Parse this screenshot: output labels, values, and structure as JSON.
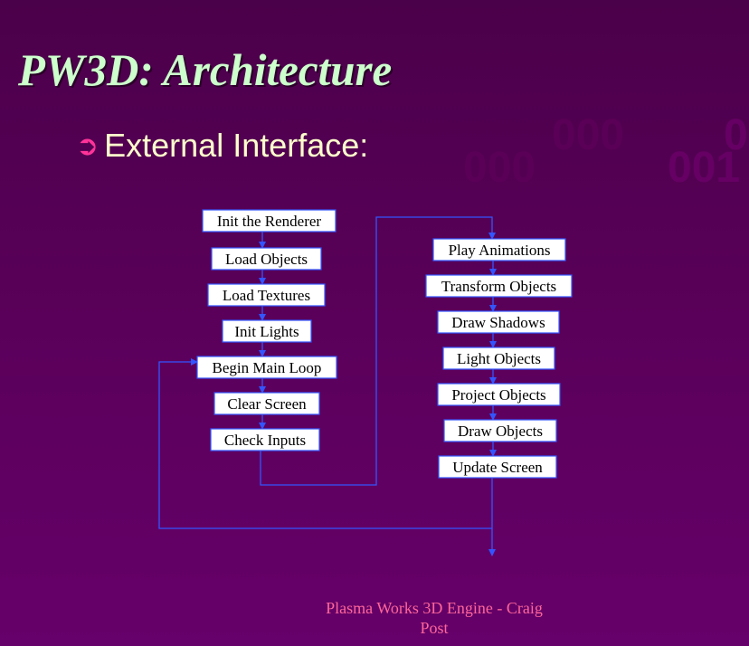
{
  "slide": {
    "title": "PW3D: Architecture",
    "bullet": {
      "icon": "arrow-right-circle-icon",
      "text": "External Interface:"
    },
    "background_digits": [
      "000",
      "000",
      "001",
      "0"
    ],
    "footer_line1": "Plasma Works 3D Engine - Craig",
    "footer_line2": "Post"
  },
  "diagram": {
    "left_column": [
      "Init the Renderer",
      "Load Objects",
      "Load Textures",
      "Init Lights",
      "Begin Main Loop",
      "Clear Screen",
      "Check Inputs"
    ],
    "right_column": [
      "Play Animations",
      "Transform Objects",
      "Draw Shadows",
      "Light Objects",
      "Project Objects",
      "Draw Objects",
      "Update Screen"
    ],
    "colors": {
      "box_fill": "#ffffff",
      "box_border": "#3355ff",
      "arrow": "#3355ff",
      "title": "#ccffcc",
      "bullet_text": "#ffffcc",
      "bullet_icon": "#ff3399",
      "footer": "#ff6699"
    }
  }
}
